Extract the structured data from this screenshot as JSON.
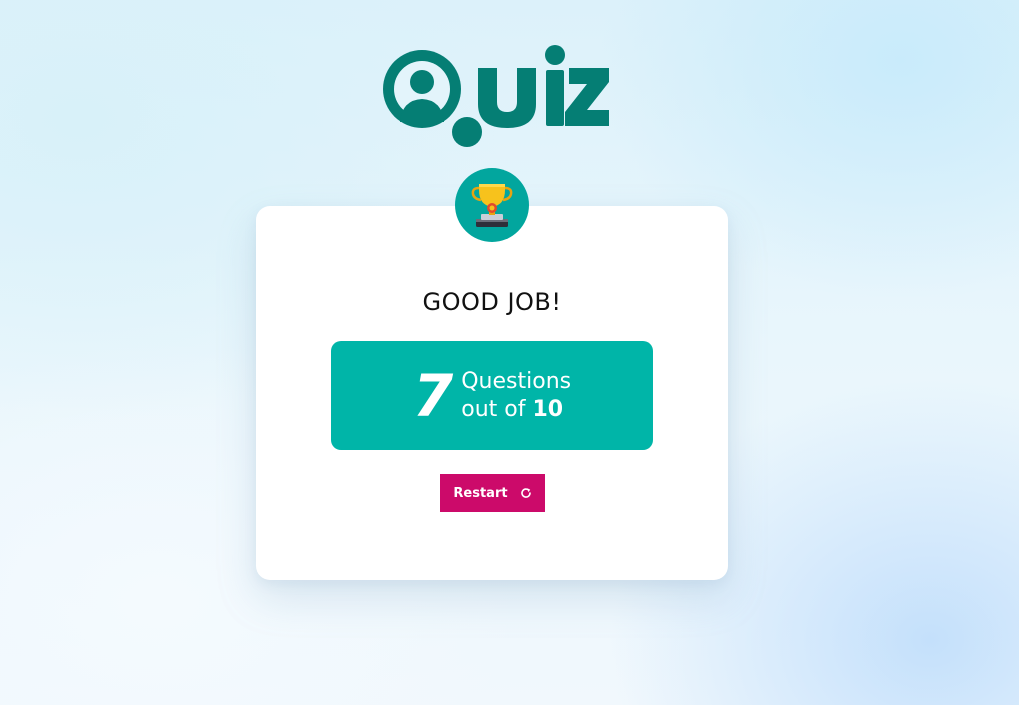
{
  "app": {
    "logo_text": "Quiz",
    "brand_color": "#057e74",
    "accent_color": "#00b5a8",
    "button_color": "#cc0a6a"
  },
  "result": {
    "badge_icon": "trophy-icon",
    "headline": "GOOD JOB!",
    "score": "7",
    "questions_label": "Questions",
    "out_of_label": "out of",
    "total": "10"
  },
  "actions": {
    "restart_label": "Restart",
    "restart_icon": "refresh-icon"
  }
}
